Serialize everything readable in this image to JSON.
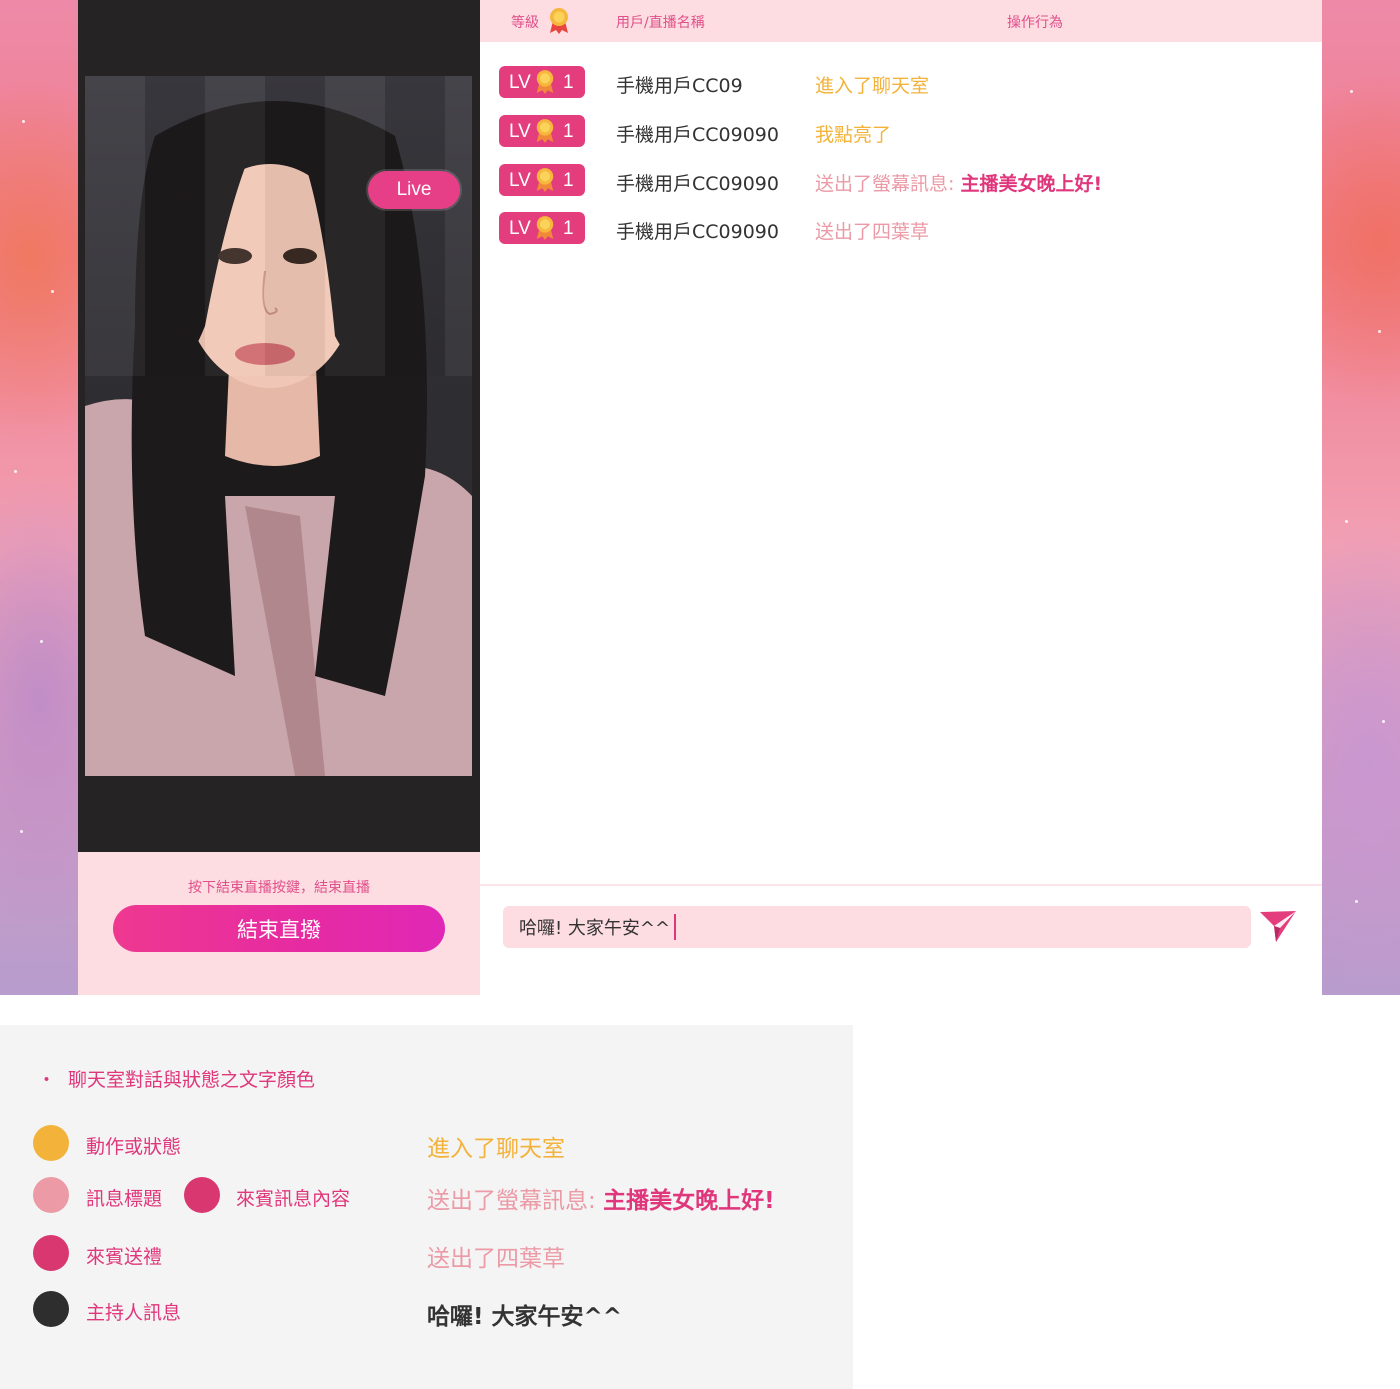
{
  "video": {
    "live_label": "Live",
    "end_hint": "按下結束直播按鍵，結束直播",
    "end_button": "結束直撥"
  },
  "chat": {
    "header": {
      "level": "等級",
      "user": "用戶/直播名稱",
      "action": "操作行為",
      "medal_icon": "medal-icon"
    },
    "rows": [
      {
        "lv": "LV",
        "level": "1",
        "user": "手機用戶CC09",
        "action": "進入了聊天室",
        "message": ""
      },
      {
        "lv": "LV",
        "level": "1",
        "user": "手機用戶CC09090",
        "action": "我點亮了",
        "message": ""
      },
      {
        "lv": "LV",
        "level": "1",
        "user": "手機用戶CC09090",
        "action": "送出了螢幕訊息: ",
        "message": "主播美女晚上好!"
      },
      {
        "lv": "LV",
        "level": "1",
        "user": "手機用戶CC09090",
        "action": "送出了四葉草",
        "message": ""
      }
    ],
    "input_value": "哈囉! 大家午安^^",
    "send_icon": "send-icon"
  },
  "legend": {
    "bullet": "・",
    "title": "聊天室對話與狀態之文字顏色",
    "items": {
      "status": "動作或狀態",
      "msg_title": "訊息標題",
      "msg_content": "來賓訊息內容",
      "gift": "來賓送禮",
      "host": "主持人訊息"
    },
    "examples": {
      "status": "進入了聊天室",
      "msg_title": "送出了螢幕訊息: ",
      "msg_content": "主播美女晚上好!",
      "gift": "送出了四葉草",
      "host": "哈囉! 大家午安^^"
    }
  },
  "colors": {
    "status_orange": "#f3b33b",
    "title_pink": "#eb9aa6",
    "content_pink": "#e0377c",
    "gift_pink": "#e0377c",
    "host_dark": "#333333",
    "accent": "#e33d7e"
  }
}
